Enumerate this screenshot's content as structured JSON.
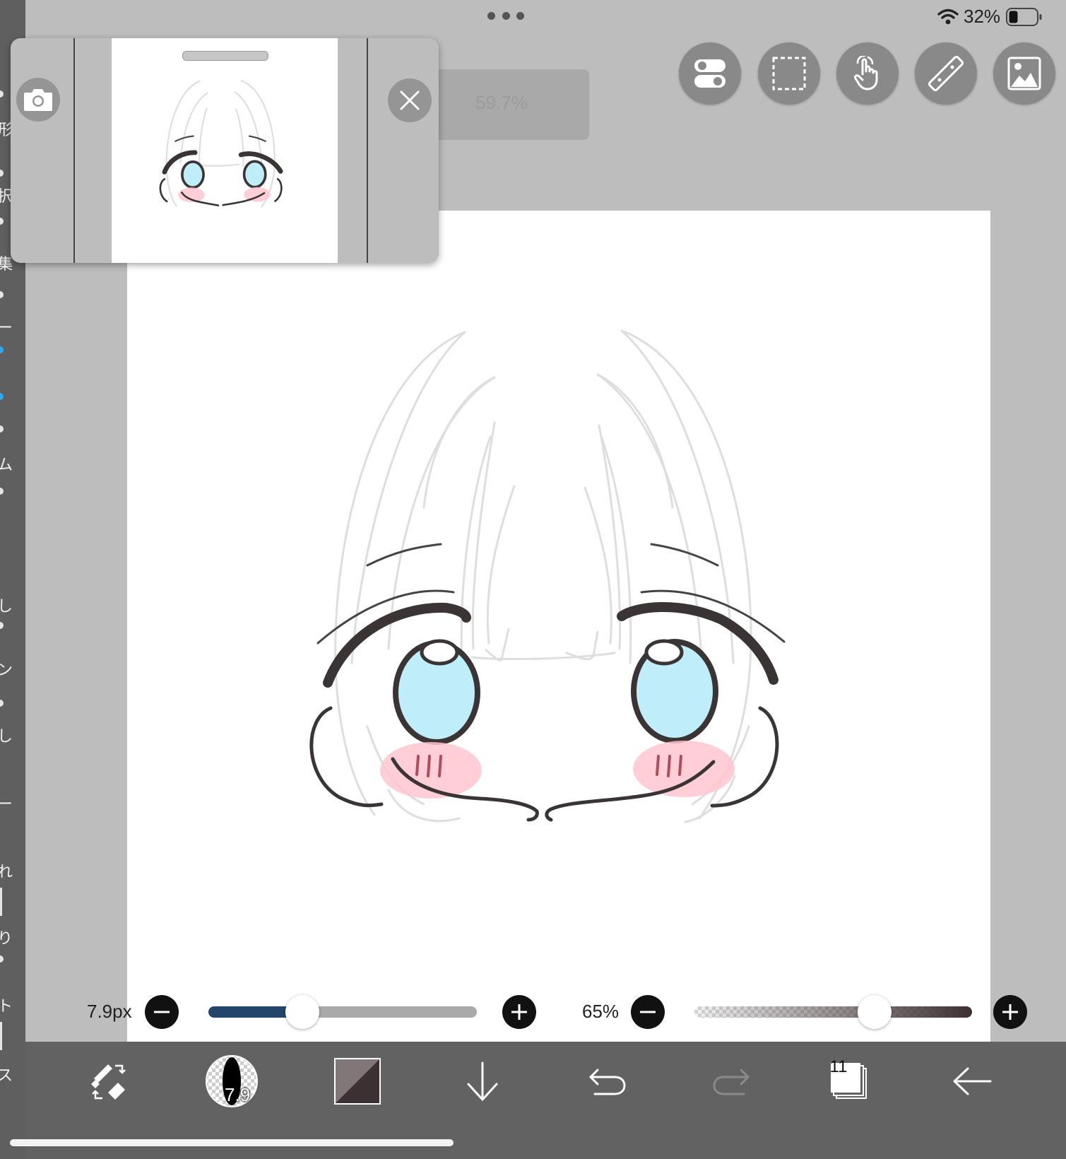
{
  "status": {
    "battery_percent": "32%"
  },
  "canvas": {
    "zoom": "59.7%"
  },
  "sidebar_fragments": [
    "形",
    "択",
    "集",
    "ー",
    "ム",
    "し",
    "ン",
    "し",
    "ー",
    "れ",
    "り",
    "ト",
    "ス"
  ],
  "brush": {
    "size_label": "7.9px",
    "size_fraction": 0.35,
    "opacity_label": "65%",
    "opacity_fraction": 0.65,
    "badge": "7.9"
  },
  "layers": {
    "count": "11"
  },
  "colors": {
    "accent": "#23456b",
    "toolbar_bg": "#626262",
    "workspace_bg": "#bdbdbd",
    "eye": "#bfeefa",
    "blush": "#ffc5d0"
  },
  "icons": {
    "tool_buttons": [
      "toggle-icon",
      "selection-icon",
      "hand-gesture-icon",
      "ruler-icon",
      "image-icon"
    ],
    "bottom_bar": [
      "pen-eraser-swap-icon",
      "brush-icon",
      "color-icon",
      "move-down-icon",
      "undo-icon",
      "redo-icon",
      "layers-icon",
      "back-icon"
    ]
  }
}
